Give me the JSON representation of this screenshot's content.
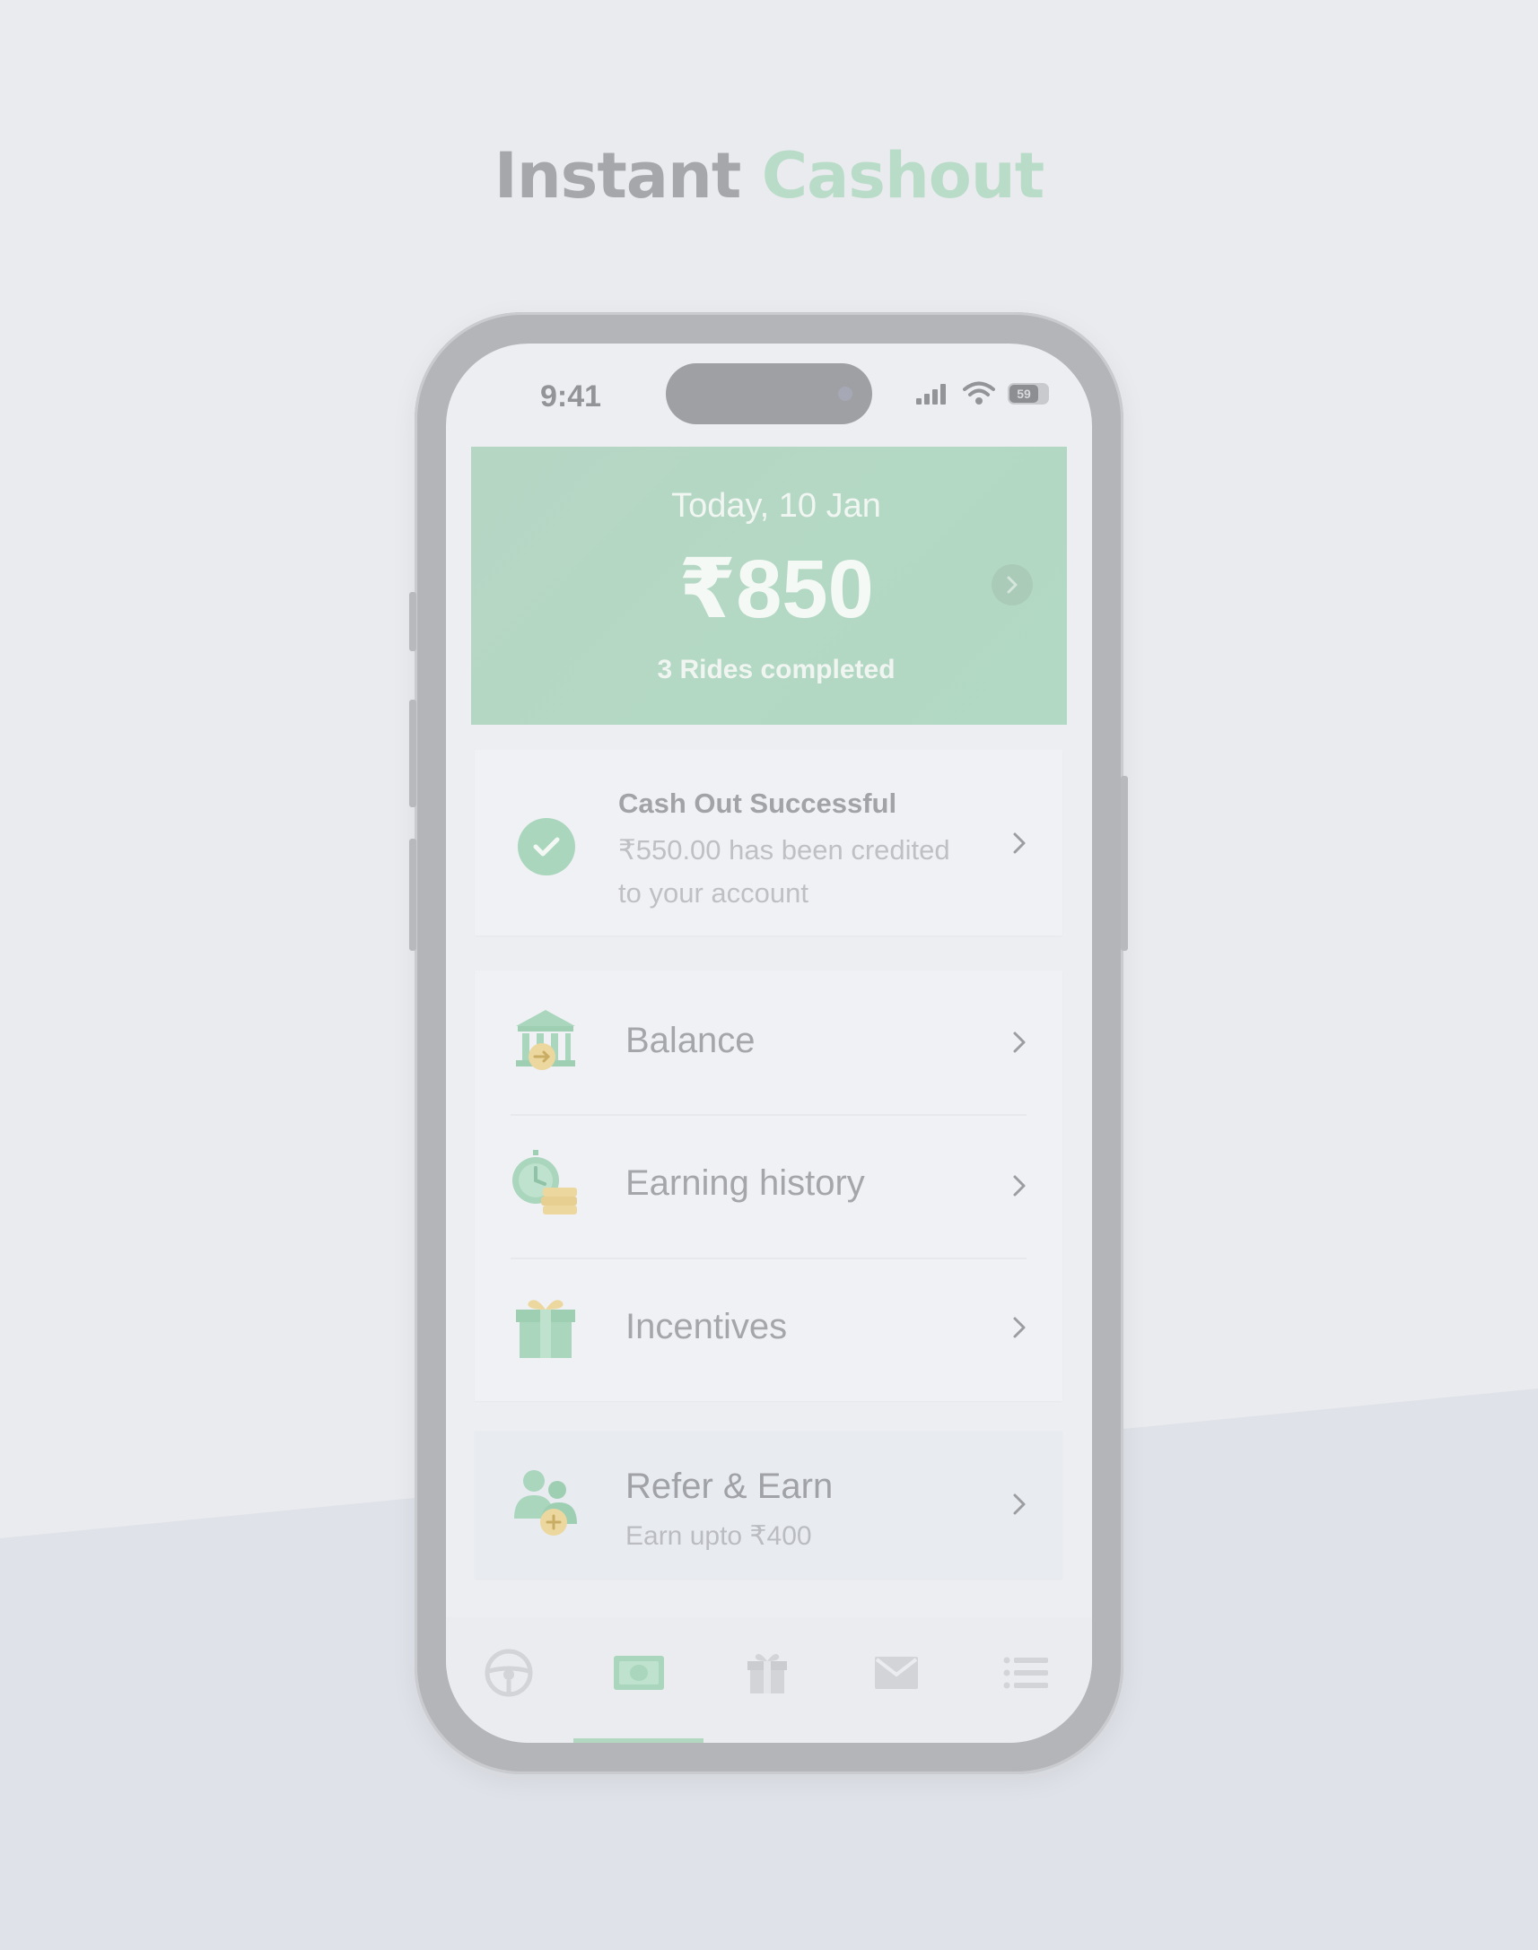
{
  "headline": {
    "word1": "Instant",
    "word2": "Cashout"
  },
  "status_bar": {
    "time": "9:41",
    "battery": "59"
  },
  "earnings": {
    "date": "Today, 10 Jan",
    "amount": "₹850",
    "rides": "3 Rides completed"
  },
  "cashout": {
    "title": "Cash Out Successful",
    "line1": "₹550.00 has been credited",
    "line2": "to your account"
  },
  "menu": {
    "items": [
      {
        "label": "Balance",
        "icon": "bank-icon"
      },
      {
        "label": "Earning history",
        "icon": "clock-coins-icon"
      },
      {
        "label": "Incentives",
        "icon": "gift-icon"
      }
    ]
  },
  "refer": {
    "label": "Refer & Earn",
    "sub": "Earn upto ₹400"
  },
  "tabs": [
    {
      "icon": "steering-wheel-icon",
      "active": false
    },
    {
      "icon": "cash-icon",
      "active": true
    },
    {
      "icon": "gift-icon",
      "active": false
    },
    {
      "icon": "mail-icon",
      "active": false
    },
    {
      "icon": "list-icon",
      "active": false
    }
  ],
  "colors": {
    "accent_green": "#b2d8c2",
    "background": "#eaebef"
  }
}
